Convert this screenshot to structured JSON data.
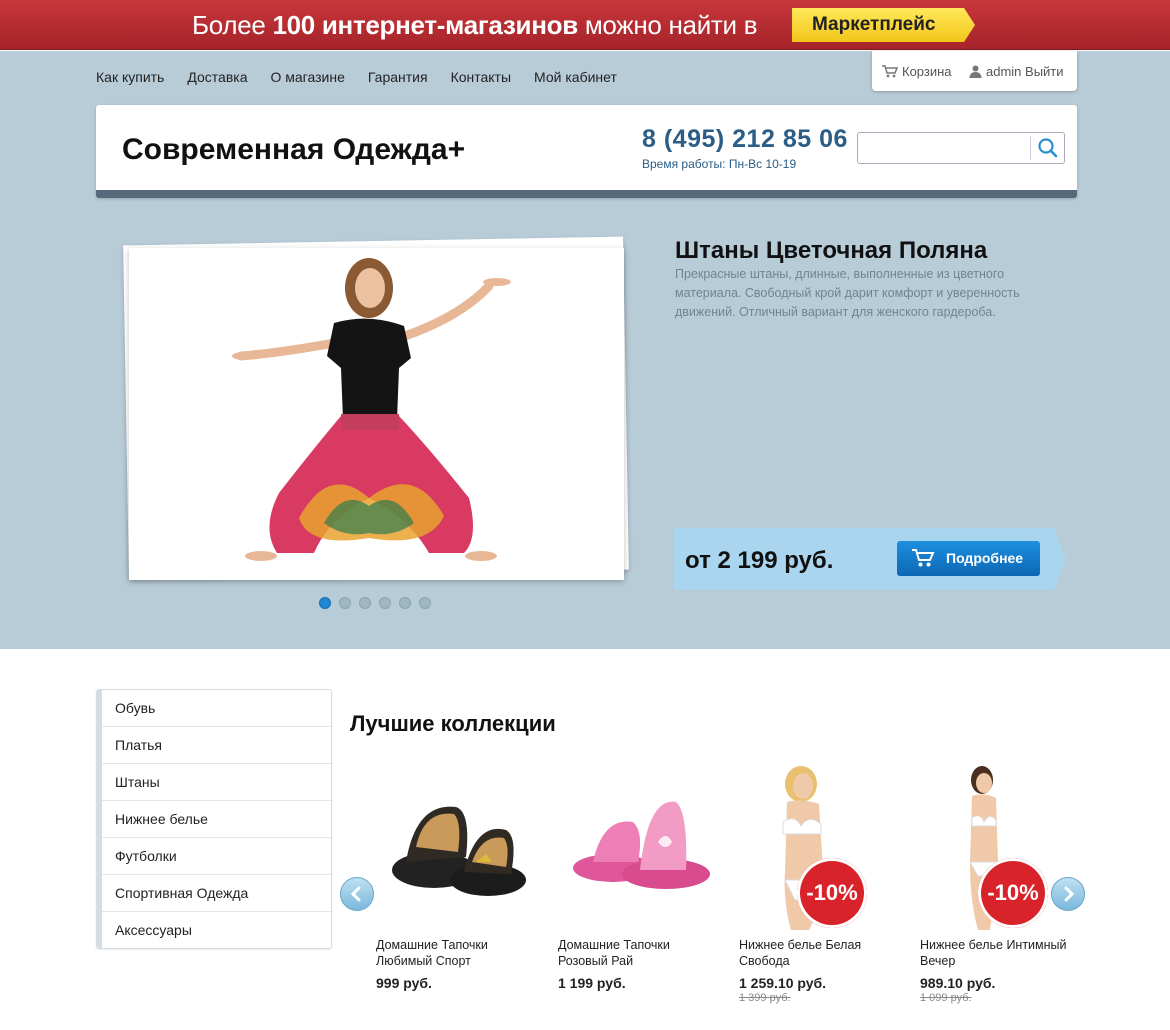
{
  "banner": {
    "text_pre": "Более ",
    "text_bold": "100 интернет-магазинов",
    "text_post": " можно найти в",
    "button": "Маркетплейс"
  },
  "nav": {
    "items": [
      "Как купить",
      "Доставка",
      "О магазине",
      "Гарантия",
      "Контакты",
      "Мой кабинет"
    ]
  },
  "userbox": {
    "cart_label": "Корзина",
    "user_label": "admin Выйти"
  },
  "header": {
    "logo": "Современная Одежда+",
    "phone": "8 (495) 212 85 06",
    "hours": "Время работы: Пн-Вс 10-19",
    "search_value": ""
  },
  "slider": {
    "title": "Штаны Цветочная Поляна",
    "description": "Прекрасные штаны, длинные, выполненные из цветного материала. Свободный крой дарит комфорт и уверенность движений. Отличный вариант для женского гардероба.",
    "price": "от 2 199 руб.",
    "button": "Подробнее",
    "slides_count": 6,
    "active_slide": 1
  },
  "categories": [
    "Обувь",
    "Платья",
    "Штаны",
    "Нижнее белье",
    "Футболки",
    "Спортивная Одежда",
    "Аксессуары"
  ],
  "collections": {
    "title": "Лучшие коллекции",
    "products": [
      {
        "name": "Домашние Тапочки Любимый Спорт",
        "price": "999 руб.",
        "old_price": "",
        "badge": ""
      },
      {
        "name": "Домашние Тапочки Розовый Рай",
        "price": "1 199 руб.",
        "old_price": "",
        "badge": ""
      },
      {
        "name": "Нижнее белье Белая Свобода",
        "price": "1 259.10 руб.",
        "old_price": "1 399 руб.",
        "badge": "-10%"
      },
      {
        "name": "Нижнее белье Интимный Вечер",
        "price": "989.10 руб.",
        "old_price": "1 099 руб.",
        "badge": "-10%"
      }
    ]
  },
  "colors": {
    "banner_red": "#b52d33",
    "hero_bg": "#b8ccd8",
    "phone_blue": "#2b5d86",
    "button_blue": "#1479c8",
    "badge_red": "#d8232a"
  }
}
